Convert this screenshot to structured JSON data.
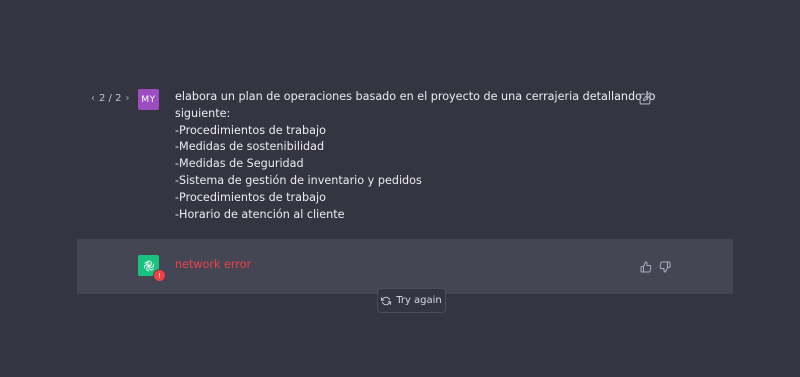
{
  "conversation": {
    "pager": {
      "prev_glyph": "‹",
      "label": "2 / 2",
      "next_glyph": "›"
    },
    "user_message": {
      "avatar_initials": "MY",
      "lines": [
        "elabora un plan de operaciones basado en el proyecto de una cerrajeria detallando lo",
        "siguiente:",
        "-Procedimientos de trabajo",
        "-Medidas de sostenibilidad",
        "-Medidas de Seguridad",
        "-Sistema de gestión de inventario y pedidos",
        "-Procedimientos de trabajo",
        "-Horario de atención al cliente"
      ],
      "edit_icon": "pencil-edit-icon"
    },
    "assistant_message": {
      "avatar_icon": "openai-logo-icon",
      "error_badge": "!",
      "error_text": "network error",
      "feedback_icons": [
        "thumbs-up-icon",
        "thumbs-down-icon"
      ]
    },
    "try_again": {
      "icon": "refresh-icon",
      "label": "Try again"
    }
  },
  "colors": {
    "background": "#343541",
    "assistant_row": "#444654",
    "user_avatar": "#9e4cc2",
    "bot_avatar": "#19c37d",
    "error": "#ef4146",
    "text": "#ececf1"
  }
}
